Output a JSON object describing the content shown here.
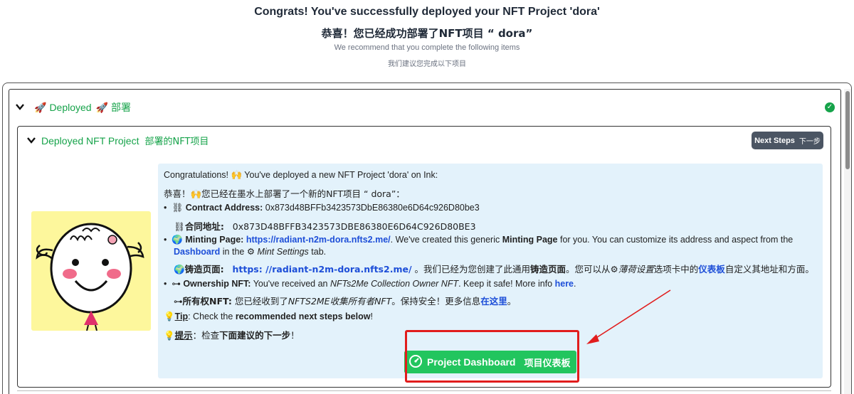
{
  "header": {
    "title_en": "Congrats! You've successfully deployed your NFT Project 'dora'",
    "title_zh": "恭喜！您已经成功部署了NFT项目 “ dora”",
    "sub_en": "We recommend that you complete the following items",
    "sub_zh": "我们建议您完成以下项目"
  },
  "section": {
    "label_en": "Deployed",
    "label_zh": "部署",
    "icon": "rocket-icon",
    "status_icon": "check-circle-icon",
    "status_color": "#16a34a"
  },
  "card": {
    "title_en": "Deployed NFT Project",
    "title_zh": "部署的NFT项目",
    "next_en": "Next Steps",
    "next_zh": "下一步"
  },
  "info": {
    "congrats_en": "Congratulations! 🙌 You've deployed a new NFT Project 'dora' on Ink:",
    "congrats_zh": "恭喜！🙌您已经在墨水上部署了一个新的NFT项目 “ dora”：",
    "contract_label": "Contract Address:",
    "contract_value": "0x873d48BFFb3423573DbE86380e6D64c926D80be3",
    "contract_label_zh": "合同地址:",
    "contract_value_zh": "0x873D48BFFB3423573DBE86380E6D64C926D80BE3",
    "minting_label": "Minting Page:",
    "minting_url": "https://radiant-n2m-dora.nfts2.me/",
    "minting_text1": ". We've created this generic ",
    "minting_bold": "Minting Page",
    "minting_text2": " for you. You can customize its address and aspect from the",
    "dashboard_link": "Dashboard",
    "minting_text3": " in the ",
    "mint_settings": "Mint Settings",
    "minting_text4": " tab.",
    "minting_label_zh": "铸造页面:",
    "minting_url_zh": "https: //radiant-n2m-dora.nfts2.me/",
    "minting_zh_text1": "。我们已经为您创建了此通用",
    "minting_zh_bold": "铸造页面",
    "minting_zh_text2": "。您可以从",
    "minting_zh_italic": "薄荷设置",
    "minting_zh_text3": "选项卡中的",
    "minting_zh_link": "仪表板",
    "minting_zh_text4": "自定义其地址和方面。",
    "ownership_label": "Ownership NFT:",
    "ownership_text1": " You've received an ",
    "ownership_italic": "NFTs2Me Collection Owner NFT",
    "ownership_text2": ". Keep it safe! More info ",
    "ownership_link": "here",
    "ownership_text3": ".",
    "ownership_label_zh": "所有权NFT:",
    "ownership_zh_text1": " 您已经收到了",
    "ownership_zh_italic": "NFTS2ME收集所有者NFT",
    "ownership_zh_text2": "。保持安全！更多信息",
    "ownership_zh_link": "在这里",
    "ownership_zh_text3": "。",
    "tip_label": "Tip",
    "tip_text1": ": Check the ",
    "tip_bold": "recommended next steps below",
    "tip_text2": "!",
    "tip_label_zh": "提示",
    "tip_zh_text1": "：检查",
    "tip_zh_bold": "下面建议的下一步",
    "tip_zh_text2": "！"
  },
  "dashboard_button": {
    "label_en": "Project Dashboard",
    "label_zh": "项目仪表板",
    "icon": "gauge-icon"
  },
  "colors": {
    "accent_green": "#16a34a",
    "button_green": "#22c55e",
    "link_blue": "#1d4ed8",
    "info_bg": "#e3f2fb",
    "highlight_red": "#e11d1d"
  }
}
